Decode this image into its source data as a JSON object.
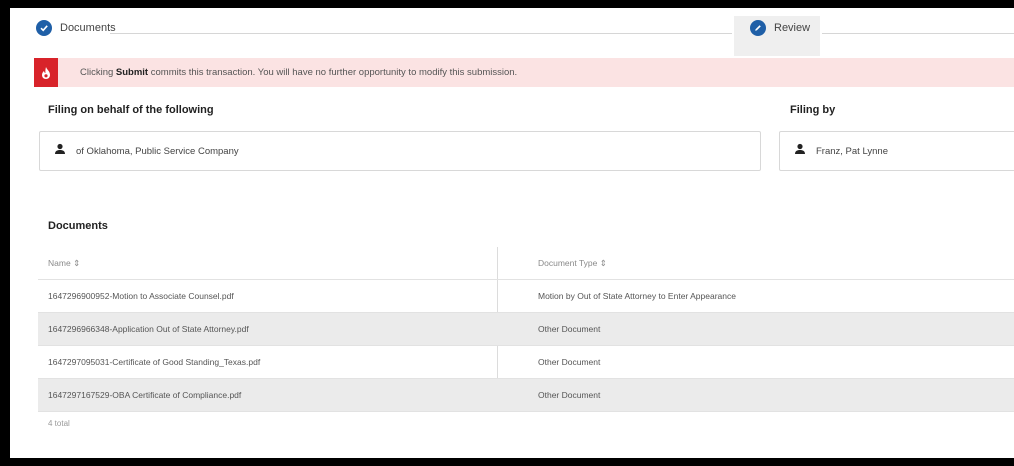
{
  "stepper": {
    "steps": [
      {
        "label": "Documents",
        "state": "complete"
      },
      {
        "label": "Review",
        "state": "active"
      }
    ]
  },
  "alert": {
    "prefix": "Clicking ",
    "emphasis": "Submit",
    "suffix": " commits this transaction. You will have no further opportunity to modify this submission."
  },
  "filing_on_behalf": {
    "heading": "Filing on behalf of the following",
    "party": "of Oklahoma, Public Service Company"
  },
  "filing_by": {
    "heading": "Filing by",
    "person": "Franz, Pat Lynne"
  },
  "documents": {
    "heading": "Documents",
    "columns": [
      "Name",
      "Document Type"
    ],
    "rows": [
      {
        "name": "1647296900952-Motion to Associate Counsel.pdf",
        "type": "Motion by Out of State Attorney to Enter Appearance"
      },
      {
        "name": "1647296966348-Application Out of State Attorney.pdf",
        "type": "Other Document"
      },
      {
        "name": "1647297095031-Certificate of Good Standing_Texas.pdf",
        "type": "Other Document"
      },
      {
        "name": "1647297167529-OBA Certificate of Compliance.pdf",
        "type": "Other Document"
      }
    ],
    "total": "4 total"
  },
  "colors": {
    "accent": "#1f5fa7",
    "alert_bg": "#fbe3e3",
    "alert_icon": "#d8232a"
  },
  "icons": {
    "documents_step": "check-icon",
    "review_step": "pencil-icon",
    "alert": "flame-icon",
    "person": "person-icon",
    "sort": "sort-icon"
  }
}
